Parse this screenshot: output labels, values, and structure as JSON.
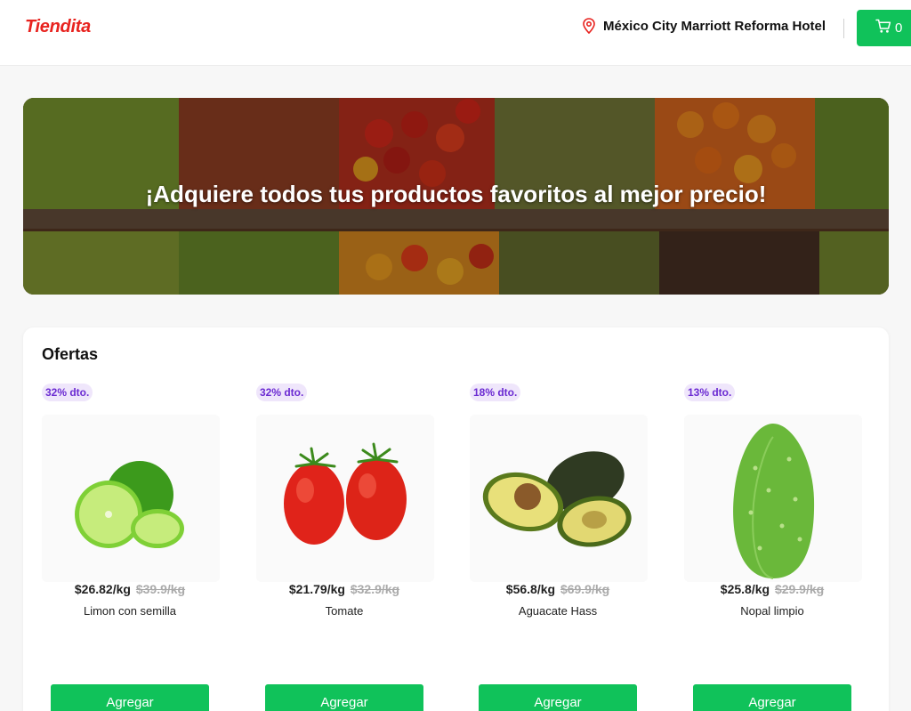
{
  "header": {
    "logo": "Tiendita",
    "location": "México City Marriott Reforma Hotel",
    "cart_count": "0",
    "icons": {
      "location": "map-pin-icon",
      "cart": "shopping-cart-icon"
    }
  },
  "banner": {
    "headline": "¡Adquiere todos tus productos favoritos al mejor precio!"
  },
  "offers": {
    "title": "Ofertas",
    "products": [
      {
        "badge": "32% dto.",
        "price": "$26.82/kg",
        "old_price": "$39.9/kg",
        "name": "Limon con semilla",
        "button": "Agregar"
      },
      {
        "badge": "32% dto.",
        "price": "$21.79/kg",
        "old_price": "$32.9/kg",
        "name": "Tomate",
        "button": "Agregar"
      },
      {
        "badge": "18% dto.",
        "price": "$56.8/kg",
        "old_price": "$69.9/kg",
        "name": "Aguacate Hass",
        "button": "Agregar"
      },
      {
        "badge": "13% dto.",
        "price": "$25.8/kg",
        "old_price": "$29.9/kg",
        "name": "Nopal limpio",
        "button": "Agregar"
      }
    ]
  },
  "colors": {
    "brand": "#e8231f",
    "accent": "#10c25a",
    "badge_text": "#6b2bd2",
    "badge_bg": "#efe6fb"
  }
}
